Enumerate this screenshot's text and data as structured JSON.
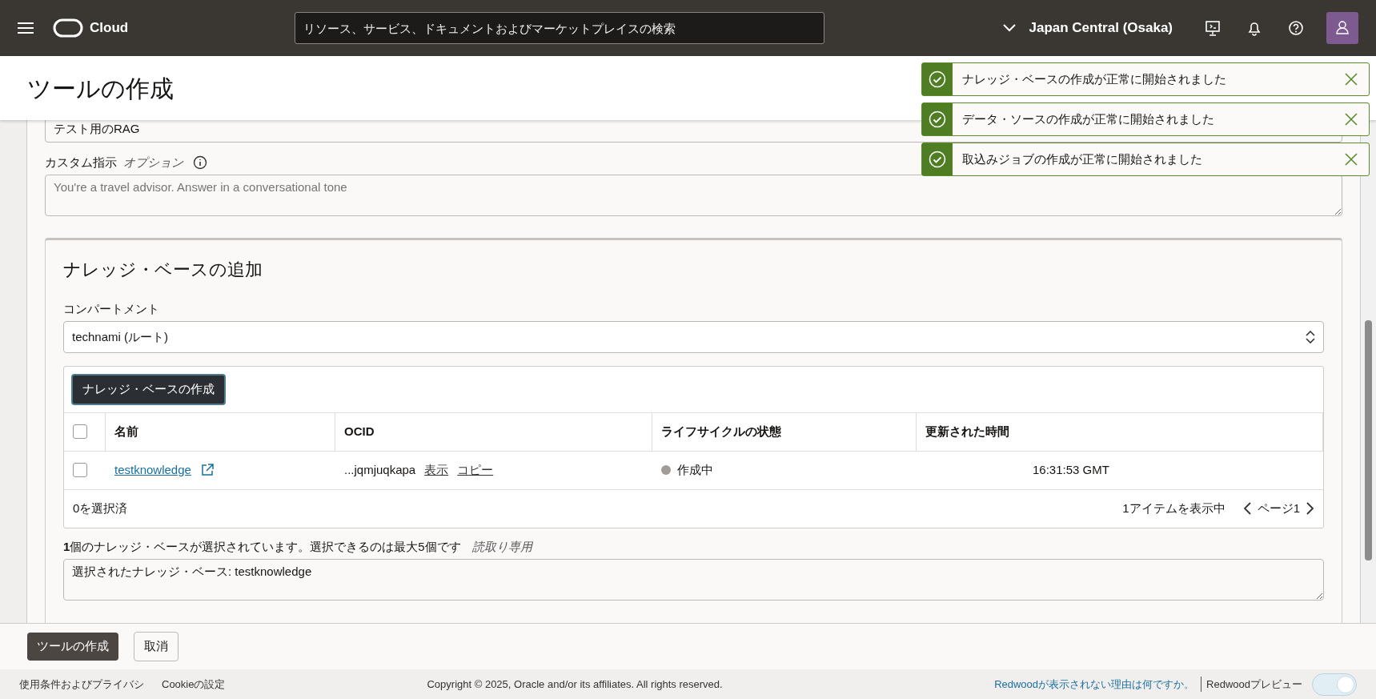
{
  "header": {
    "logo_text": "Cloud",
    "search": {
      "placeholder": "リソース、サービス、ドキュメントおよびマーケットプレイスの検索"
    },
    "region": "Japan Central (Osaka)"
  },
  "page": {
    "title": "ツールの作成"
  },
  "form": {
    "description_field": {
      "value": "テスト用のRAG"
    },
    "custom_instructions": {
      "label": "カスタム指示",
      "optional": "オプション",
      "placeholder": "You're a travel advisor. Answer in a conversational tone"
    }
  },
  "knowledge_base_section": {
    "title": "ナレッジ・ベースの追加",
    "compartment_label": "コンパートメント",
    "compartment_value": "technami (ルート)",
    "create_button": "ナレッジ・ベースの作成",
    "table": {
      "header_checked": false,
      "columns": [
        "名前",
        "OCID",
        "ライフサイクルの状態",
        "更新された時間"
      ],
      "rows": [
        {
          "checked": false,
          "name": "testknowledge",
          "ocid": "...jqmjuqkapa",
          "ocid_actions": [
            "表示",
            "コピー"
          ],
          "status": {
            "label": "作成中",
            "color": "#a09c98"
          },
          "updated": "16:31:53 GMT"
        }
      ],
      "selected_count": "0を選択済",
      "items_shown": "1アイテムを表示中",
      "page": "ページ1"
    },
    "selection_note": "**1**個のナレッジ・ベースが選択されています。選択できるのは最大5個です",
    "read_only": "読取り専用",
    "selected_value": "選択されたナレッジ・ベース: testknowledge"
  },
  "actions": [
    {
      "label": "ツールの作成",
      "kind": "primary"
    },
    {
      "label": "取消",
      "kind": "secondary"
    }
  ],
  "footer": {
    "links": [
      "使用条件およびプライバシ",
      "Cookieの設定"
    ],
    "copyright": "Copyright © 2025, Oracle and/or its affiliates. All rights reserved.",
    "redwood_link": "Redwoodが表示されない理由は何ですか。",
    "preview_label": "Redwoodプレビュー",
    "preview_on": true
  },
  "toasts": [
    {
      "message": "ナレッジ・ベースの作成が正常に開始されました"
    },
    {
      "message": "データ・ソースの作成が正常に開始されました"
    },
    {
      "message": "取込みジョブの作成が正常に開始されました"
    }
  ]
}
